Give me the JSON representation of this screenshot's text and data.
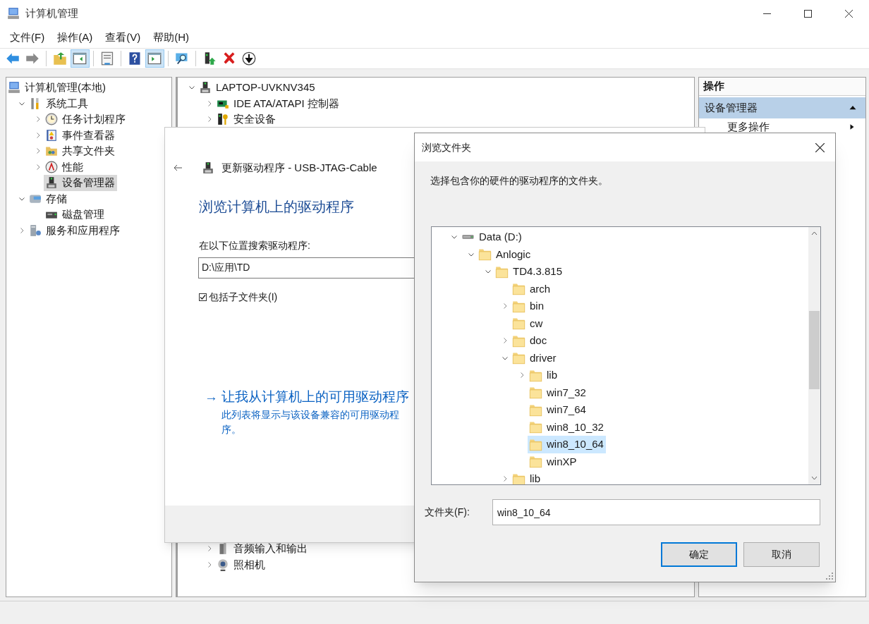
{
  "window": {
    "title": "计算机管理"
  },
  "menu": [
    "文件(F)",
    "操作(A)",
    "查看(V)",
    "帮助(H)"
  ],
  "toolbar": [
    {
      "pressed": false
    },
    {
      "pressed": false
    },
    {
      "pressed": false
    },
    {
      "pressed": true
    },
    {
      "pressed": false
    },
    {
      "pressed": false
    },
    {
      "pressed": true
    },
    {
      "pressed": false
    },
    {
      "pressed": false
    },
    {
      "pressed": false
    },
    {
      "pressed": false
    }
  ],
  "navigation_tree": [
    {
      "label": "计算机管理(本地)",
      "selected": false,
      "children": [
        {
          "label": "系统工具",
          "expanded": true,
          "selected": false,
          "children": [
            {
              "label": "任务计划程序",
              "expanded": false,
              "selected": false
            },
            {
              "label": "事件查看器",
              "expanded": false,
              "selected": false
            },
            {
              "label": "共享文件夹",
              "expanded": false,
              "selected": false
            },
            {
              "label": "性能",
              "expanded": false,
              "selected": false
            },
            {
              "label": "设备管理器",
              "selected": true
            }
          ]
        },
        {
          "label": "存储",
          "expanded": true,
          "selected": false,
          "children": [
            {
              "label": "磁盘管理",
              "selected": false
            }
          ]
        },
        {
          "label": "服务和应用程序",
          "expanded": false,
          "selected": false
        }
      ]
    }
  ],
  "device_tree": [
    {
      "label": "LAPTOP-UVKNV345",
      "expanded": true,
      "selected": false,
      "children": [
        {
          "label": "IDE ATA/ATAPI 控制器",
          "expanded": false,
          "selected": false
        },
        {
          "label": "安全设备",
          "expanded": false,
          "selected": false
        },
        {
          "label": "音频输入和输出",
          "expanded": false,
          "selected": false
        },
        {
          "label": "照相机",
          "expanded": false,
          "selected": false
        }
      ]
    }
  ],
  "actions_pane": {
    "header": "操作",
    "section": {
      "label": "设备管理器",
      "expanded": true
    },
    "items": [
      "更多操作"
    ]
  },
  "update_driver_wizard": {
    "title": "更新驱动程序 - USB-JTAG-Cable",
    "heading": "浏览计算机上的驱动程序",
    "search_label": "在以下位置搜索驱动程序:",
    "path": "D:\\应用\\TD",
    "include_subfolders": {
      "label": "包括子文件夹(I)",
      "checked": true
    },
    "pick_link": "→ 让我从计算机上的可用驱动程序",
    "pick_description": [
      "此列表将显示与该设备兼容的可用驱动程",
      "序。"
    ]
  },
  "browse_dialog": {
    "title": "浏览文件夹",
    "instruction": "选择包含你的硬件的驱动程序的文件夹。",
    "tree": [
      {
        "label": "Data (D:)",
        "expanded": true,
        "selected": false,
        "children": [
          {
            "label": "Anlogic",
            "expanded": true,
            "selected": false,
            "children": [
              {
                "label": "TD4.3.815",
                "expanded": true,
                "selected": false,
                "children": [
                  {
                    "label": "arch",
                    "selected": false
                  },
                  {
                    "label": "bin",
                    "expanded": false,
                    "selected": false
                  },
                  {
                    "label": "cw",
                    "selected": false
                  },
                  {
                    "label": "doc",
                    "expanded": false,
                    "selected": false
                  },
                  {
                    "label": "driver",
                    "expanded": true,
                    "selected": false,
                    "children": [
                      {
                        "label": "lib",
                        "expanded": false,
                        "selected": false
                      },
                      {
                        "label": "win7_32",
                        "selected": false
                      },
                      {
                        "label": "win7_64",
                        "selected": false
                      },
                      {
                        "label": "win8_10_32",
                        "selected": false
                      },
                      {
                        "label": "win8_10_64",
                        "selected": true
                      },
                      {
                        "label": "winXP",
                        "selected": false
                      }
                    ]
                  },
                  {
                    "label": "lib",
                    "expanded": false,
                    "selected": false
                  }
                ]
              }
            ]
          }
        ]
      }
    ],
    "folder_label": "文件夹(F):",
    "folder_value": "win8_10_64",
    "buttons": [
      {
        "label": "确定",
        "default": true
      },
      {
        "label": "取消",
        "default": false
      }
    ]
  }
}
